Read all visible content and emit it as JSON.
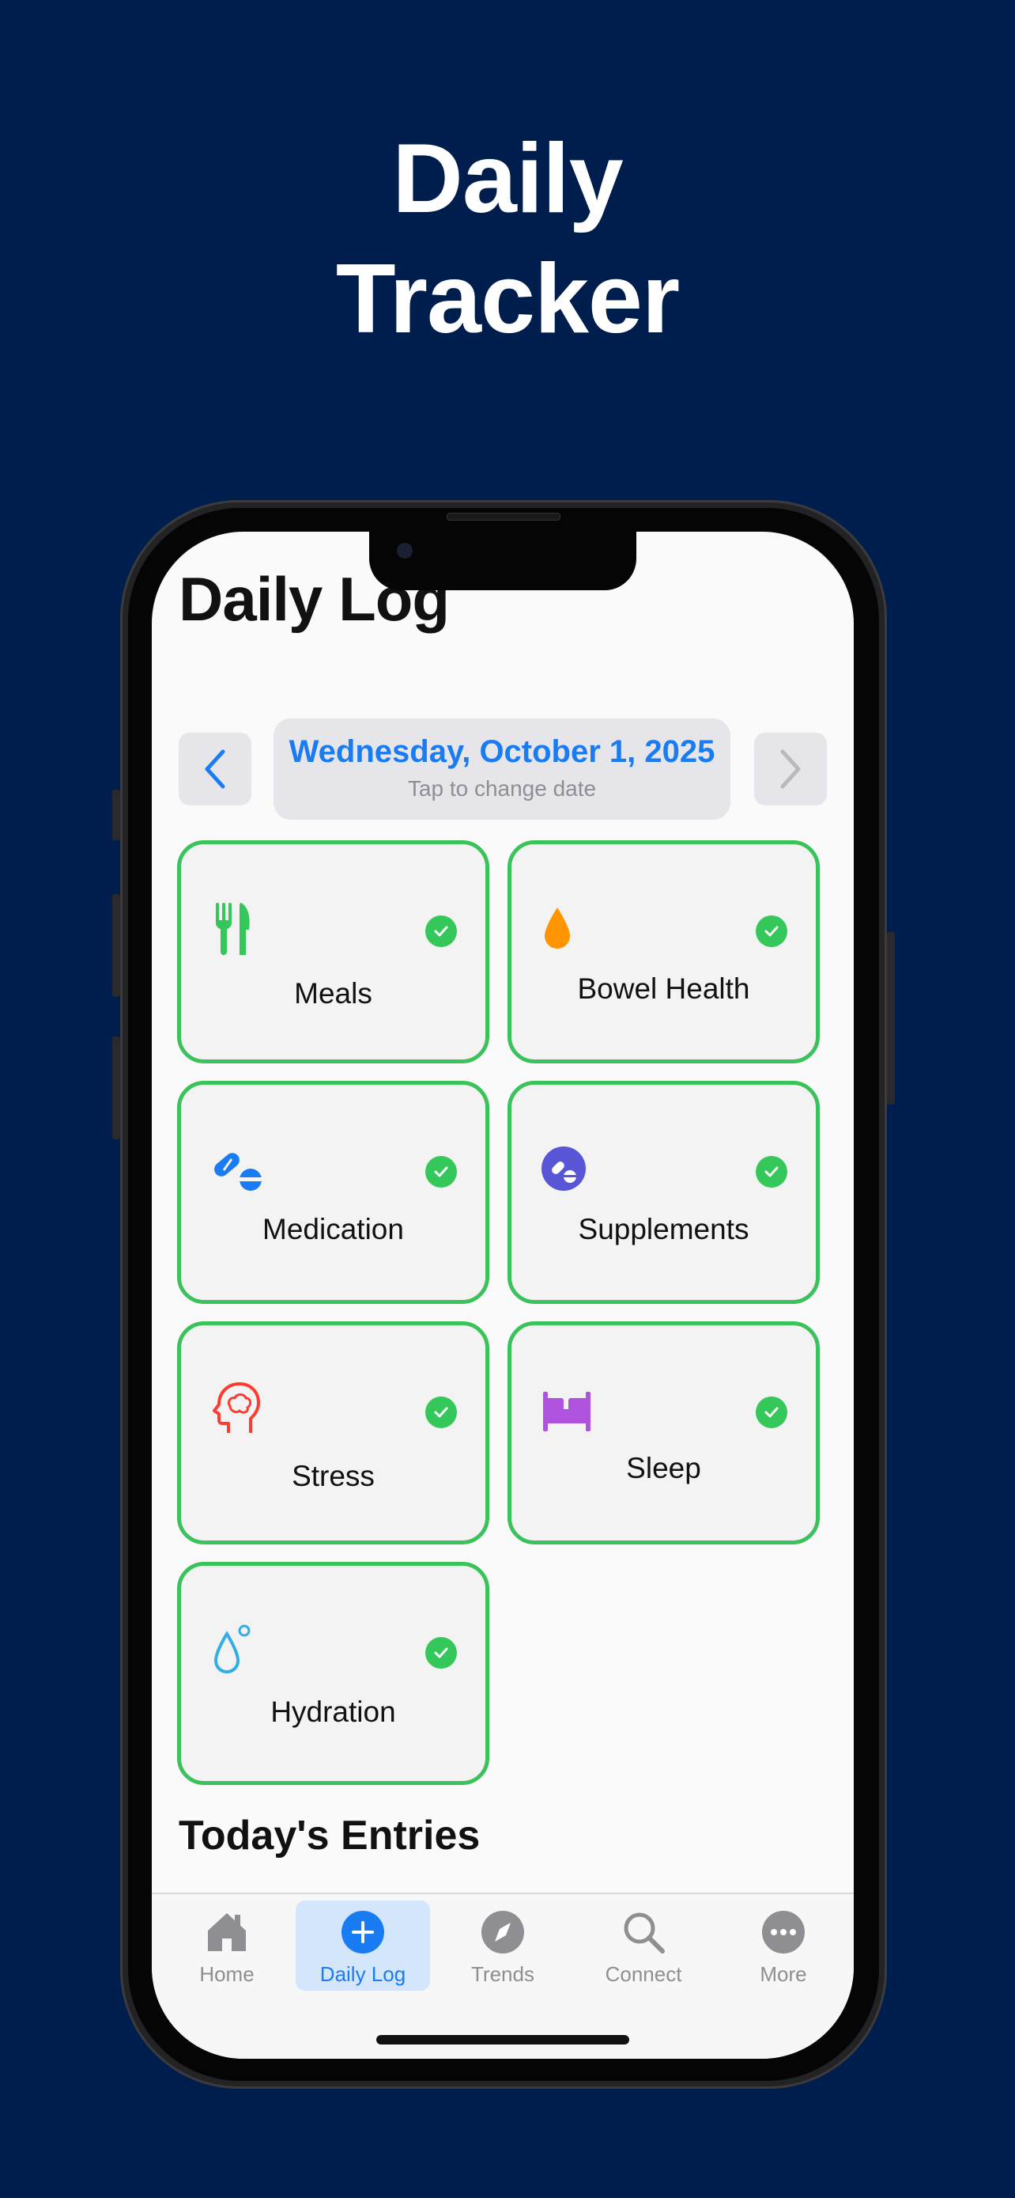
{
  "headline": {
    "line1": "Daily",
    "line2": "Tracker"
  },
  "screen": {
    "title": "Daily Log",
    "date": {
      "label": "Wednesday, October 1, 2025",
      "hint": "Tap to change date"
    },
    "cards": [
      {
        "label": "Meals",
        "icon": "fork-knife-icon",
        "icon_color": "#34c759",
        "completed": true
      },
      {
        "label": "Bowel Health",
        "icon": "drop-icon",
        "icon_color": "#ff9500",
        "completed": true
      },
      {
        "label": "Medication",
        "icon": "pills-icon",
        "icon_color": "#1a7cf2",
        "completed": true
      },
      {
        "label": "Supplements",
        "icon": "capsules-circle-icon",
        "icon_color": "#5856d6",
        "completed": true
      },
      {
        "label": "Stress",
        "icon": "head-brain-icon",
        "icon_color": "#ff3b30",
        "completed": true
      },
      {
        "label": "Sleep",
        "icon": "bed-icon",
        "icon_color": "#af52de",
        "completed": true
      },
      {
        "label": "Hydration",
        "icon": "water-drop-icon",
        "icon_color": "#32ade6",
        "completed": true
      }
    ],
    "section_title": "Today's Entries",
    "tabs": [
      {
        "label": "Home",
        "icon": "house-icon",
        "active": false
      },
      {
        "label": "Daily Log",
        "icon": "plus-circle-icon",
        "active": true
      },
      {
        "label": "Trends",
        "icon": "compass-icon",
        "active": false
      },
      {
        "label": "Connect",
        "icon": "magnifier-icon",
        "active": false
      },
      {
        "label": "More",
        "icon": "ellipsis-circle-icon",
        "active": false
      }
    ]
  },
  "colors": {
    "background": "#001e4d",
    "accent": "#1a7cf2",
    "complete_green": "#34c759"
  }
}
